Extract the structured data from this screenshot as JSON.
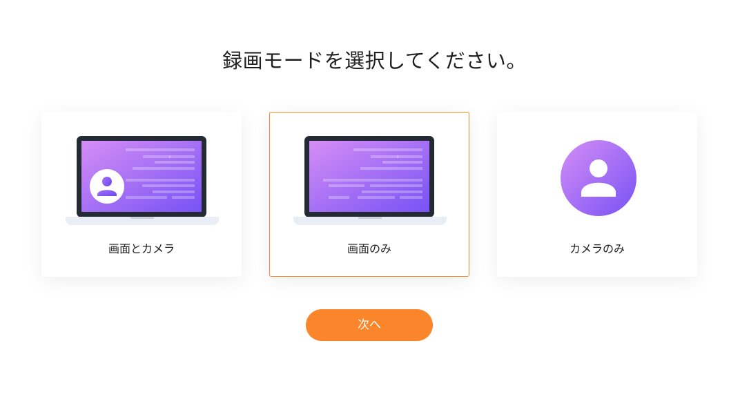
{
  "header": {
    "title": "録画モードを選択してください。"
  },
  "options": [
    {
      "label": "画面とカメラ",
      "icon": "laptop-with-avatar-icon",
      "selected": false
    },
    {
      "label": "画面のみ",
      "icon": "laptop-screen-icon",
      "selected": true
    },
    {
      "label": "カメラのみ",
      "icon": "user-avatar-icon",
      "selected": false
    }
  ],
  "footer": {
    "next_label": "次へ"
  },
  "colors": {
    "accent": "#fb852a",
    "selected_border": "#f58a2c",
    "gradient_start": "#d58ef5",
    "gradient_end": "#7752f5",
    "laptop_frame": "#232a33"
  }
}
